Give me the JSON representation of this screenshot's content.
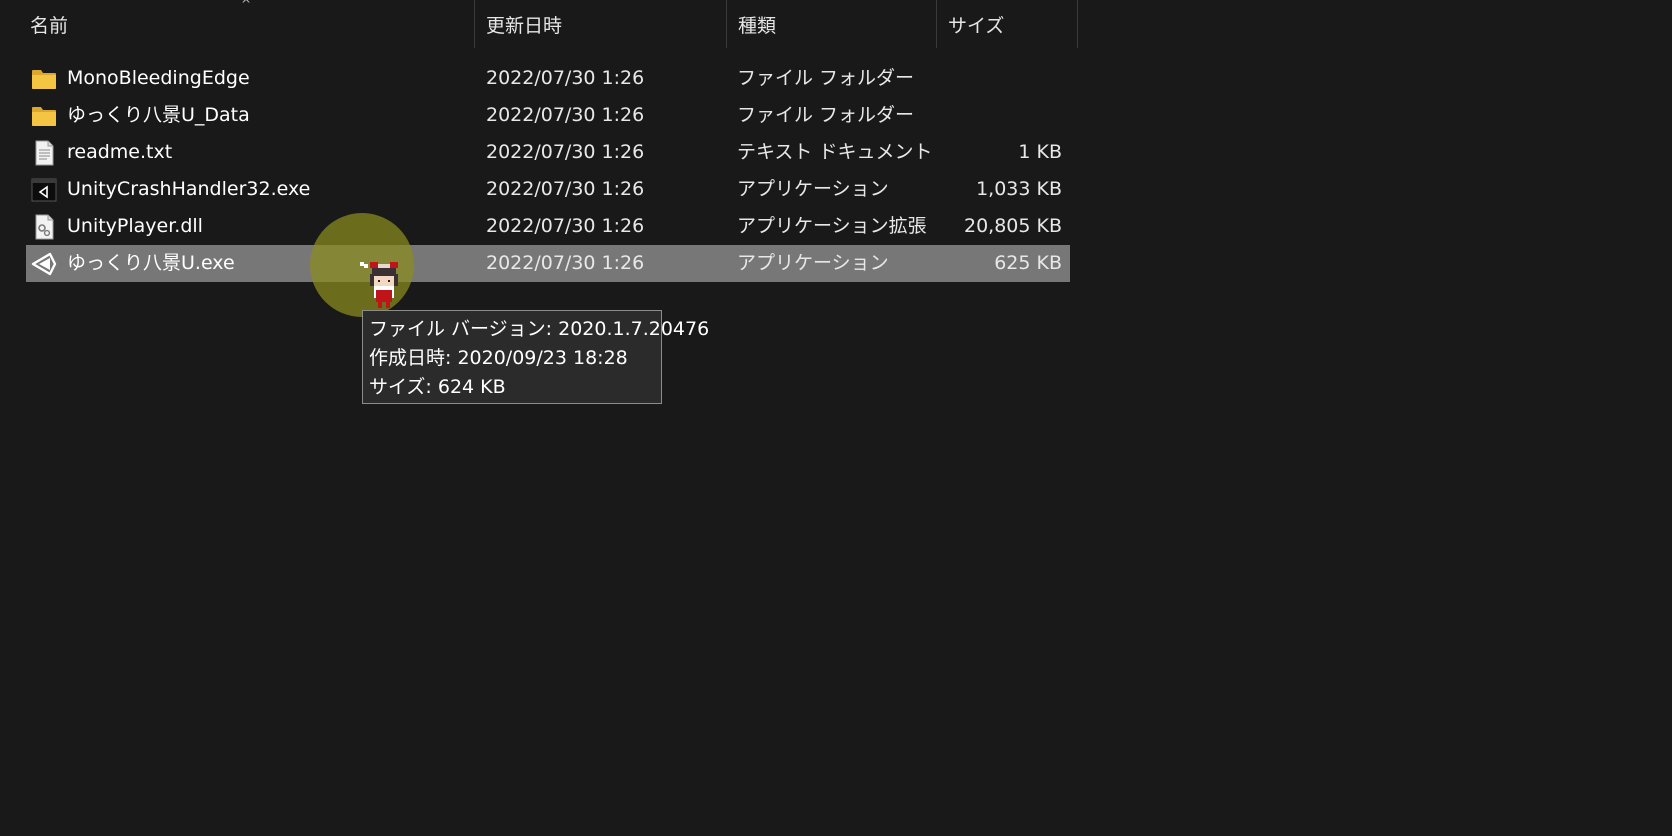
{
  "columns": {
    "name": "名前",
    "date": "更新日時",
    "type": "種類",
    "size": "サイズ"
  },
  "sort_indicator": "^",
  "files": [
    {
      "name": "MonoBleedingEdge",
      "date": "2022/07/30 1:26",
      "type": "ファイル フォルダー",
      "size": "",
      "icon": "folder-icon"
    },
    {
      "name": "ゆっくり八景U_Data",
      "date": "2022/07/30 1:26",
      "type": "ファイル フォルダー",
      "size": "",
      "icon": "folder-icon"
    },
    {
      "name": "readme.txt",
      "date": "2022/07/30 1:26",
      "type": "テキスト ドキュメント",
      "size": "1 KB",
      "icon": "text-file-icon"
    },
    {
      "name": "UnityCrashHandler32.exe",
      "date": "2022/07/30 1:26",
      "type": "アプリケーション",
      "size": "1,033 KB",
      "icon": "unity-app-icon"
    },
    {
      "name": "UnityPlayer.dll",
      "date": "2022/07/30 1:26",
      "type": "アプリケーション拡張",
      "size": "20,805 KB",
      "icon": "dll-file-icon"
    },
    {
      "name": "ゆっくり八景U.exe",
      "date": "2022/07/30 1:26",
      "type": "アプリケーション",
      "size": "625 KB",
      "icon": "unity-logo-icon"
    }
  ],
  "selected_index": 5,
  "tooltip": {
    "version": "ファイル バージョン: 2020.1.7.20476",
    "created": "作成日時: 2020/09/23 18:28",
    "size": "サイズ: 624 KB"
  },
  "colors": {
    "background": "#191919",
    "selected_row": "#777777",
    "folder": "#f4c542",
    "cursor_halo": "#8c8c1e"
  }
}
